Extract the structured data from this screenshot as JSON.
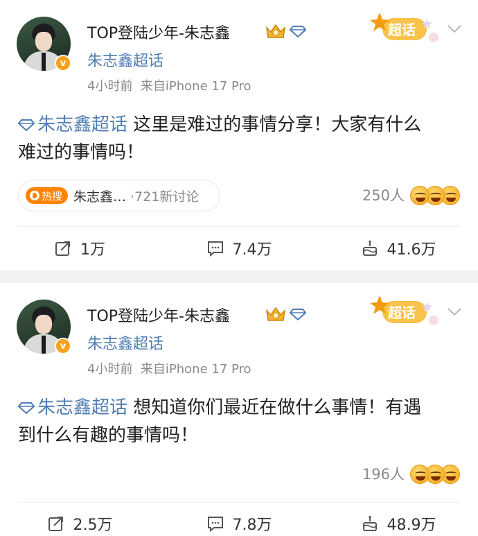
{
  "posts": [
    {
      "author": "TOP登陆少年-朱志鑫",
      "topic": "朱志鑫超话",
      "time": "4小时前",
      "source": "来自iPhone 17 Pro",
      "supertopic_badge": "超话",
      "content_tag": "朱志鑫超话",
      "content_line1": " 这里是难过的事情分享！大家有什么",
      "content_line2": "难过的事情吗！",
      "hot_badge": "热搜",
      "hot_title": "朱志鑫…",
      "hot_count": "·721新讨论",
      "reaction_count": "250人",
      "actions": {
        "repost": "1万",
        "comment": "7.4万",
        "like": "41.6万"
      }
    },
    {
      "author": "TOP登陆少年-朱志鑫",
      "topic": "朱志鑫超话",
      "time": "4小时前",
      "source": "来自iPhone 17 Pro",
      "supertopic_badge": "超话",
      "content_tag": "朱志鑫超话",
      "content_line1": " 想知道你们最近在做什么事情！有遇",
      "content_line2": "到什么有趣的事情吗！",
      "reaction_count": "196人",
      "actions": {
        "repost": "2.5万",
        "comment": "7.8万",
        "like": "48.9万"
      }
    }
  ],
  "colors": {
    "link": "#4f7db4",
    "hot": "#ff8200",
    "verified": "#f7a11a",
    "supertopic": "#f6b93b"
  },
  "icons": [
    "verified-v-icon",
    "crown-icon",
    "diamond-icon",
    "supertopic-star-icon",
    "chevron-down-icon",
    "repost-icon",
    "comment-icon",
    "like-cake-icon",
    "reaction-emoji-icon"
  ]
}
